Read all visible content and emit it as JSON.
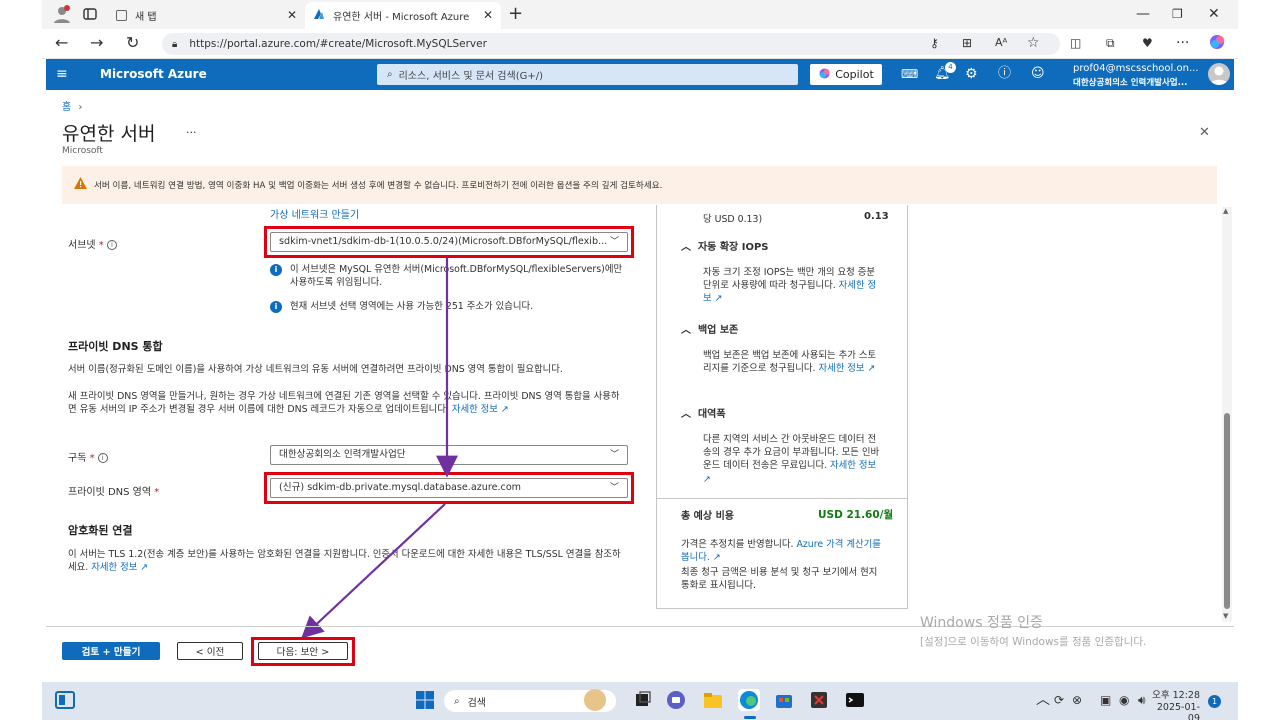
{
  "browser": {
    "tabs": [
      {
        "label": "새 탭"
      },
      {
        "label": "유연한 서버 - Microsoft Azure"
      }
    ],
    "url": "https://portal.azure.com/#create/Microsoft.MySQLServer"
  },
  "azure": {
    "brand": "Microsoft Azure",
    "search_placeholder": "리소스, 서비스 및 문서 검색(G+/)",
    "copilot": "Copilot",
    "notification_count": "4",
    "account_email": "prof04@mscsschool.on...",
    "account_org": "대한상공회의소 인력개발사업..."
  },
  "page": {
    "breadcrumb": "홈",
    "title": "유연한 서버",
    "subtitle": "Microsoft",
    "more": "···",
    "close": "✕",
    "warning": "서버 이름, 네트워킹 연결 방법, 영역 이중화 HA 및 백업 이중화는 서버 생성 후에 변경할 수 없습니다. 프로비전하기 전에 이러한 옵션을 주의 깊게 검토하세요."
  },
  "form": {
    "create_vnet_link": "가상 네트워크 만들기",
    "subnet_label": "서브넷",
    "subnet_value": "sdkim-vnet1/sdkim-db-1(10.0.5.0/24)(Microsoft.DBforMySQL/flexib...",
    "subnet_info1": "이 서브넷은 MySQL 유연한 서버(Microsoft.DBforMySQL/flexibleServers)에만 사용하도록 위임됩니다.",
    "subnet_info2": "현재 서브넷 선택 영역에는 사용 가능한 251 주소가 있습니다.",
    "dns_heading": "프라이빗 DNS 통합",
    "dns_desc1": "서버 이름(정규화된 도메인 이름)을 사용하여 가상 네트워크의 유동 서버에 연결하려면 프라이빗 DNS 영역 통합이 필요합니다.",
    "dns_desc2": "새 프라이빗 DNS 영역을 만들거나, 원하는 경우 가상 네트워크에 연결된 기존 영역을 선택할 수 있습니다. 프라이빗 DNS 영역 통합을 사용하면 유동 서버의 IP 주소가 변경될 경우 서버 이름에 대한 DNS 레코드가 자동으로 업데이트됩니다.",
    "learn_more": "자세한 정보",
    "subscription_label": "구독",
    "subscription_value": "대한상공회의소 인력개발사업단",
    "dns_zone_label": "프라이빗 DNS 영역",
    "dns_zone_value": "(신규) sdkim-db.private.mysql.database.azure.com",
    "tls_heading": "암호화된 연결",
    "tls_desc": "이 서버는 TLS 1.2(전송 계층 보안)를 사용하는 암호화된 연결을 지원합니다. 인증서 다운로드에 대한 자세한 내용은 TLS/SSL 연결을 참조하세요."
  },
  "cost_pane": {
    "top_line": "당 USD 0.13)",
    "top_value": "0.13",
    "sections": [
      {
        "title": "자동 확장 IOPS",
        "body": "자동 크기 조정 IOPS는 백만 개의 요청 증분 단위로 사용량에 따라 청구됩니다."
      },
      {
        "title": "백업 보존",
        "body": "백업 보존은 백업 보존에 사용되는 추가 스토리지를 기준으로 청구됩니다."
      },
      {
        "title": "대역폭",
        "body": "다른 지역의 서비스 간 아웃바운드 데이터 전송의 경우 추가 요금이 부과됩니다. 모든 인바운드 데이터 전송은 무료입니다."
      }
    ],
    "total_label": "총 예상 비용",
    "total_value": "USD 21.60/월",
    "note1": "가격은 추정치를 반영합니다.",
    "note_link": "Azure 가격 계산기를 봅니다.",
    "note2": "최종 청구 금액은 비용 분석 및 청구 보기에서 현지 통화로 표시됩니다."
  },
  "footer": {
    "review_create": "검토 + 만들기",
    "previous": "< 이전",
    "next": "다음: 보안 >"
  },
  "watermark": {
    "line1": "Windows 정품 인증",
    "line2": "[설정]으로 이동하여 Windows를 정품 인증합니다."
  },
  "taskbar": {
    "search": "검색",
    "time": "오후 12:28",
    "date": "2025-01-09",
    "badge": "1"
  },
  "colors": {
    "azure_blue": "#0f6cbd",
    "highlight_red": "#e00010",
    "arrow_purple": "#7030a0",
    "warning_bg": "#fdf0e6"
  }
}
